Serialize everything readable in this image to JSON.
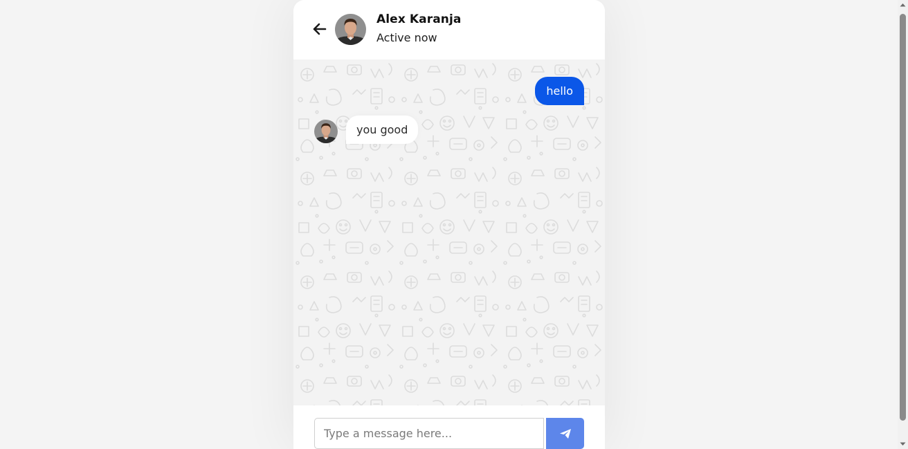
{
  "header": {
    "back_icon": "arrow-left-icon",
    "user_name": "Alex Karanja",
    "status": "Active now"
  },
  "messages": [
    {
      "direction": "outgoing",
      "text": "hello"
    },
    {
      "direction": "incoming",
      "text": "you good"
    }
  ],
  "input": {
    "placeholder": "Type a message here...",
    "value": ""
  },
  "send_button": {
    "icon": "paper-plane-icon"
  },
  "colors": {
    "outgoing_bubble": "#0b57e8",
    "send_button": "#5d86ea",
    "page_background": "#f4f4f4",
    "chat_background": "#f3f3f3"
  }
}
